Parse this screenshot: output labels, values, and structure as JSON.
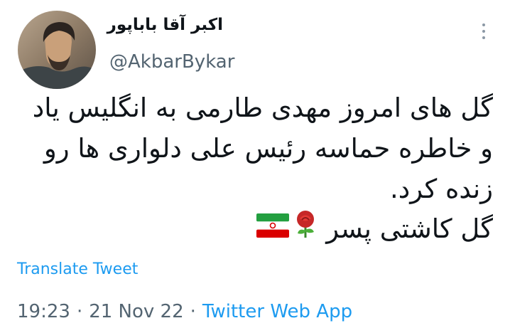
{
  "author": {
    "display_name": "اکبر آقا باباپور",
    "handle": "@AkbarBykar"
  },
  "tweet": {
    "lines": [
      "گل های امروز مهدی طارمی به انگلیس یاد",
      "و خاطره حماسه رئیس علی دلواری ها رو",
      "زنده کرد.",
      "گل کاشتی پسر"
    ],
    "emojis": [
      "rose-emoji",
      "iran-flag-emoji"
    ]
  },
  "translate_label": "Translate Tweet",
  "meta": {
    "time": "19:23",
    "separator": "·",
    "date": "21 Nov 22",
    "source": "Twitter Web App"
  },
  "icons": {
    "more": "more-vertical-icon"
  },
  "colors": {
    "link": "#1d9bf0",
    "secondary_text": "#536471",
    "primary_text": "#0f1419"
  }
}
